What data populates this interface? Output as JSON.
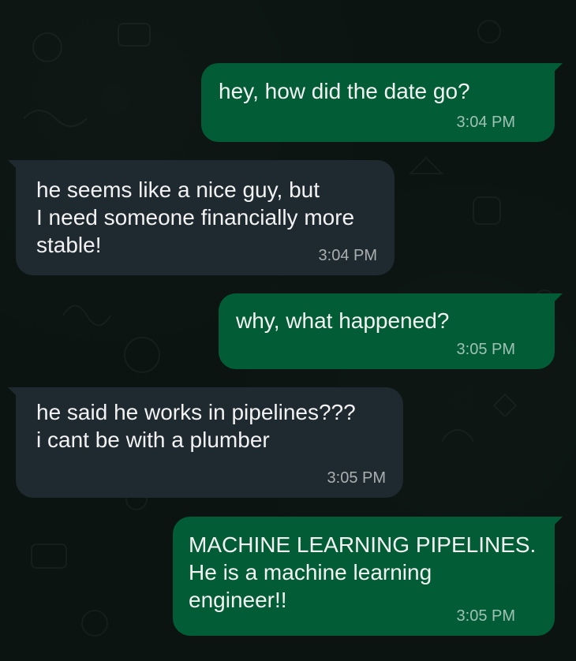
{
  "colors": {
    "background": "#0b1411",
    "outgoing_bubble": "#025c36",
    "incoming_bubble": "#1e2a2f",
    "text": "#f2f2f2",
    "timestamp": "#a8b0ad"
  },
  "messages": [
    {
      "direction": "outgoing",
      "text": "hey, how did the date go?",
      "time": "3:04 PM"
    },
    {
      "direction": "incoming",
      "text": "he seems like a nice guy, but\nI need someone financially more\nstable!",
      "time": "3:04 PM"
    },
    {
      "direction": "outgoing",
      "text": "why, what happened?",
      "time": "3:05 PM"
    },
    {
      "direction": "incoming",
      "text": "he said he works in pipelines???\ni cant be with a plumber",
      "time": "3:05 PM"
    },
    {
      "direction": "outgoing",
      "text": "MACHINE LEARNING PIPELINES.\nHe is a machine learning\nengineer!!",
      "time": "3:05 PM"
    }
  ]
}
